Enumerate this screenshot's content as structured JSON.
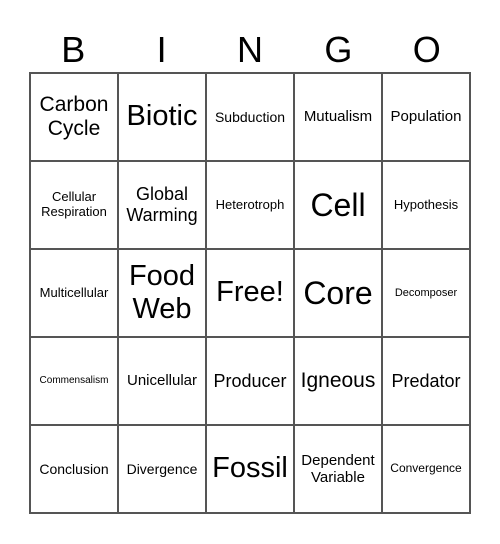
{
  "header": {
    "letters": [
      "B",
      "I",
      "N",
      "G",
      "O"
    ]
  },
  "board": {
    "cells": [
      "Carbon Cycle",
      "Biotic",
      "Subduction",
      "Mutualism",
      "Population",
      "Cellular Respiration",
      "Global Warming",
      "Heterotroph",
      "Cell",
      "Hypothesis",
      "Multicellular",
      "Food Web",
      "Free!",
      "Core",
      "Decomposer",
      "Commensalism",
      "Unicellular",
      "Producer",
      "Igneous",
      "Predator",
      "Conclusion",
      "Divergence",
      "Fossil",
      "Dependent Variable",
      "Convergence"
    ]
  }
}
